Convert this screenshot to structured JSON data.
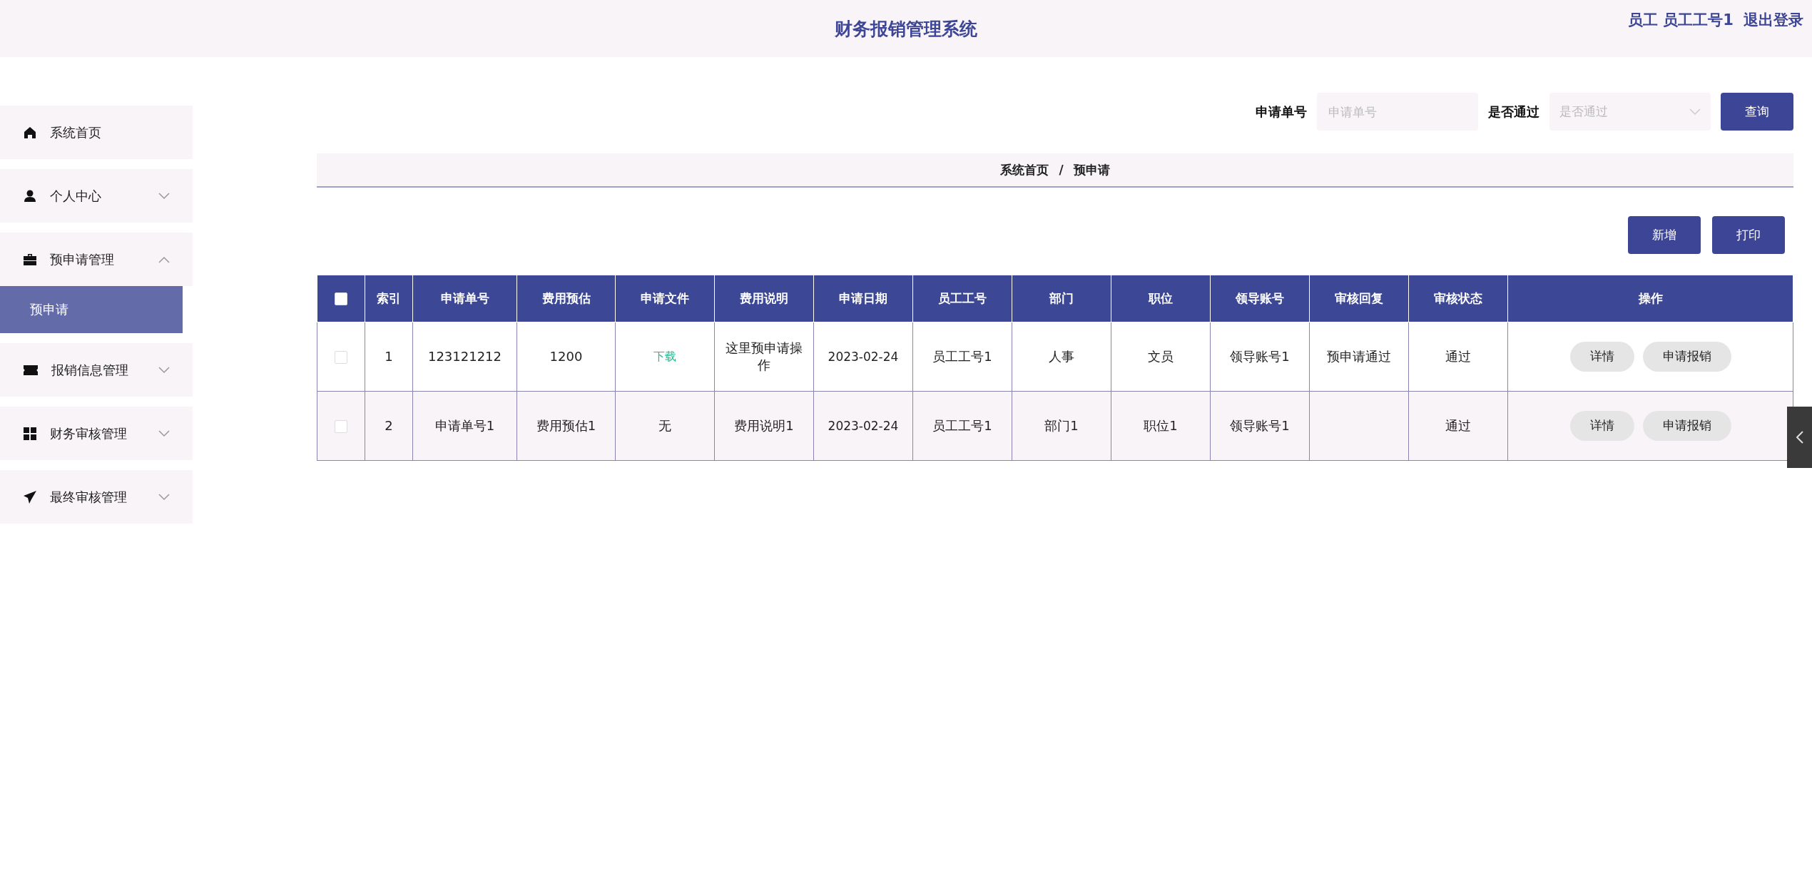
{
  "header": {
    "title": "财务报销管理系统",
    "user": "员工 员工工号1",
    "logout": "退出登录"
  },
  "sidebar": {
    "items": [
      {
        "label": "系统首页",
        "kind": "link"
      },
      {
        "label": "个人中心",
        "kind": "menu",
        "expanded": false
      },
      {
        "label": "预申请管理",
        "kind": "menu",
        "expanded": true,
        "children": [
          {
            "label": "预申请",
            "selected": true
          }
        ]
      },
      {
        "label": "报销信息管理",
        "kind": "menu",
        "expanded": false
      },
      {
        "label": "财务审核管理",
        "kind": "menu",
        "expanded": false
      },
      {
        "label": "最终审核管理",
        "kind": "menu",
        "expanded": false
      }
    ]
  },
  "search": {
    "fields": [
      {
        "label": "申请单号",
        "placeholder": "申请单号",
        "kind": "input"
      },
      {
        "label": "是否通过",
        "placeholder": "是否通过",
        "kind": "select"
      }
    ],
    "button": "查询"
  },
  "breadcrumb": [
    "系统首页",
    "预申请"
  ],
  "breadcrumb_separator": "/",
  "actions": [
    "新增",
    "打印"
  ],
  "table": {
    "header_checked": false,
    "columns": [
      "索引",
      "申请单号",
      "费用预估",
      "申请文件",
      "费用说明",
      "申请日期",
      "员工工号",
      "部门",
      "职位",
      "领导账号",
      "审核回复",
      "审核状态",
      "操作"
    ],
    "rows": [
      {
        "checked": false,
        "cells": [
          {
            "text": "1"
          },
          {
            "text": "123121212"
          },
          {
            "text": "1200"
          },
          {
            "text": "下载",
            "kind": "link"
          },
          {
            "text": "这里预申请操作"
          },
          {
            "text": "2023-02-24",
            "kind": "date"
          },
          {
            "text": "员工工号1"
          },
          {
            "text": "人事"
          },
          {
            "text": "文员"
          },
          {
            "text": "领导账号1"
          },
          {
            "text": "预申请通过"
          },
          {
            "text": "通过"
          }
        ],
        "buttons": [
          "详情",
          "申请报销"
        ]
      },
      {
        "checked": false,
        "cells": [
          {
            "text": "2"
          },
          {
            "text": "申请单号1"
          },
          {
            "text": "费用预估1"
          },
          {
            "text": "无"
          },
          {
            "text": "费用说明1"
          },
          {
            "text": "2023-02-24",
            "kind": "date"
          },
          {
            "text": "员工工号1"
          },
          {
            "text": "部门1"
          },
          {
            "text": "职位1"
          },
          {
            "text": "领导账号1"
          },
          {
            "text": ""
          },
          {
            "text": "通过"
          }
        ],
        "buttons": [
          "详情",
          "申请报销"
        ]
      }
    ]
  }
}
